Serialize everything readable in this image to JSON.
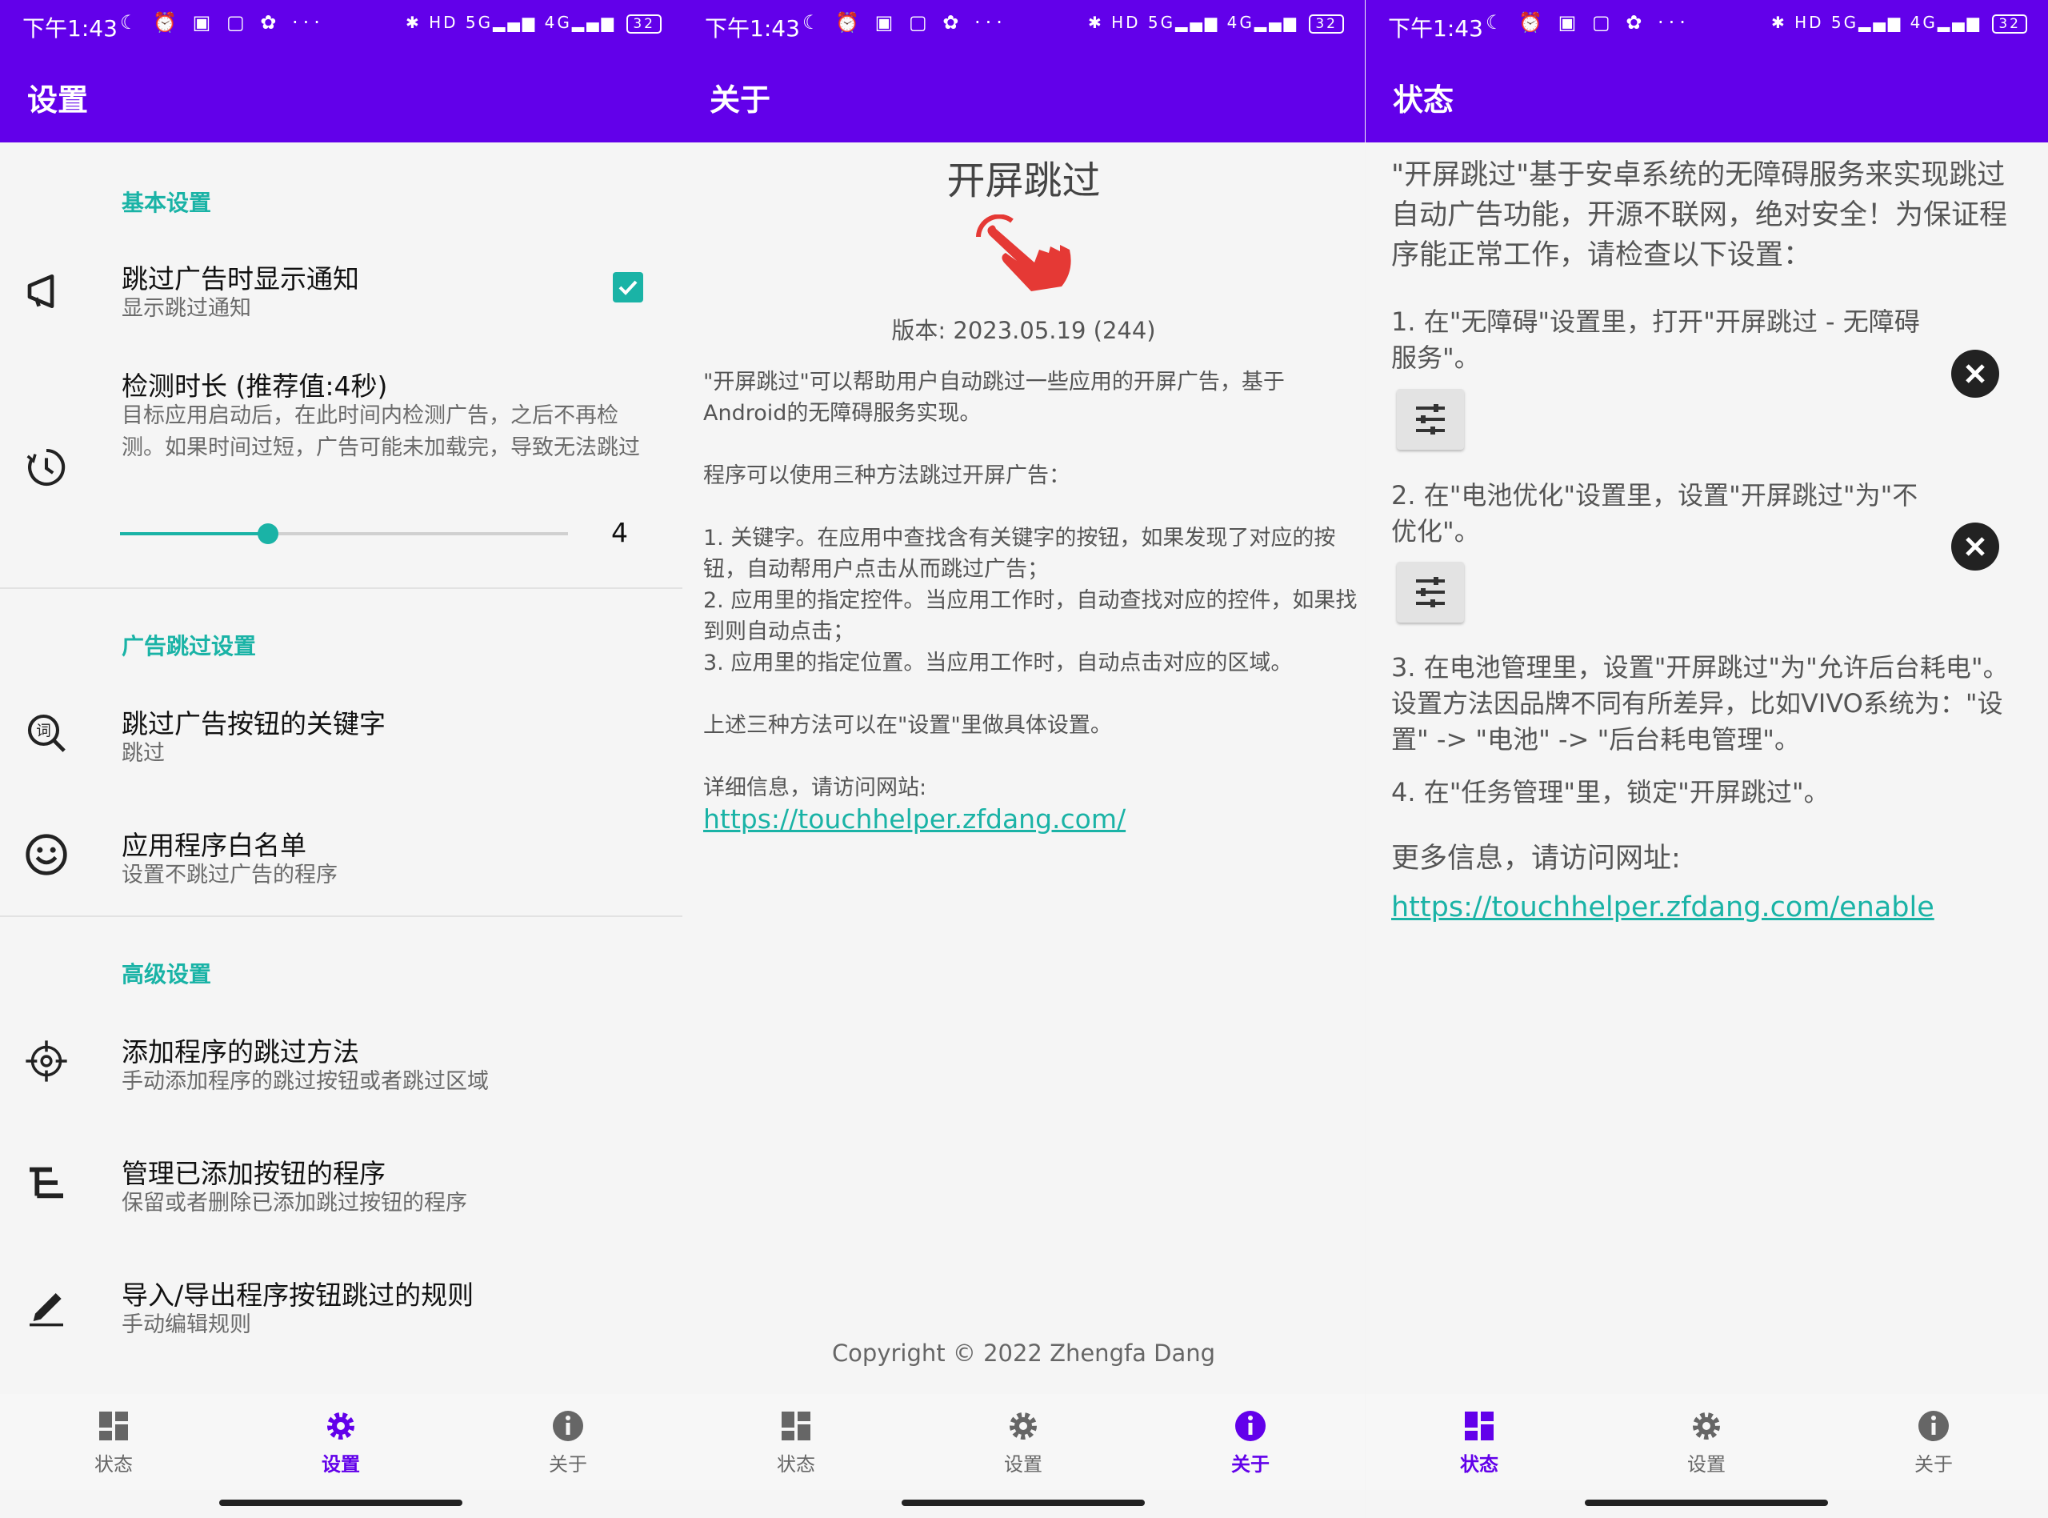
{
  "status_bar": {
    "time": "下午1:43",
    "left_icons": "☾ ⏰ ▣ ▢ ✿ ···",
    "right_icons": "✱ HD 5G▂▄▆ 4G▂▄▆",
    "battery": "32"
  },
  "colors": {
    "primary": "#6200ea",
    "accent": "#1ab3a6",
    "link": "#1ab3a6"
  },
  "settings_screen": {
    "title": "设置",
    "section_basic": "基本设置",
    "pref_notify": {
      "title": "跳过广告时显示通知",
      "subtitle": "显示跳过通知",
      "checked": true
    },
    "pref_duration": {
      "title": "检测时长 (推荐值:4秒)",
      "subtitle": "目标应用启动后，在此时间内检测广告，之后不再检测。如果时间过短，广告可能未加载完，导致无法跳过",
      "value": "4",
      "fraction": 0.33
    },
    "section_ad": "广告跳过设置",
    "pref_keywords": {
      "title": "跳过广告按钮的关键字",
      "subtitle": "跳过"
    },
    "pref_whitelist": {
      "title": "应用程序白名单",
      "subtitle": "设置不跳过广告的程序"
    },
    "section_advanced": "高级设置",
    "pref_add_method": {
      "title": "添加程序的跳过方法",
      "subtitle": "手动添加程序的跳过按钮或者跳过区域"
    },
    "pref_manage": {
      "title": "管理已添加按钮的程序",
      "subtitle": "保留或者删除已添加跳过按钮的程序"
    },
    "pref_import": {
      "title": "导入/导出程序按钮跳过的规则",
      "subtitle": "手动编辑规则"
    }
  },
  "about_screen": {
    "title": "关于",
    "app_name": "开屏跳过",
    "version": "版本: 2023.05.19 (244)",
    "para1": "\"开屏跳过\"可以帮助用户自动跳过一些应用的开屏广告，基于Android的无障碍服务实现。",
    "para2": "程序可以使用三种方法跳过开屏广告：",
    "method1": "1. 关键字。在应用中查找含有关键字的按钮，如果发现了对应的按钮，自动帮用户点击从而跳过广告；",
    "method2": "2. 应用里的指定控件。当应用工作时，自动查找对应的控件，如果找到则自动点击；",
    "method3": "3. 应用里的指定位置。当应用工作时，自动点击对应的区域。",
    "para3": "上述三种方法可以在\"设置\"里做具体设置。",
    "para4": "详细信息，请访问网站:",
    "link": "https://touchhelper.zfdang.com/",
    "copyright": "Copyright © 2022 Zhengfa Dang"
  },
  "status_screen": {
    "title": "状态",
    "intro": "\"开屏跳过\"基于安卓系统的无障碍服务来实现跳过自动广告功能，开源不联网，绝对安全！为保证程序能正常工作，请检查以下设置：",
    "step1": "1. 在\"无障碍\"设置里，打开\"开屏跳过 - 无障碍服务\"。",
    "step2": "2. 在\"电池优化\"设置里，设置\"开屏跳过\"为\"不优化\"。",
    "step3": "3. 在电池管理里，设置\"开屏跳过\"为\"允许后台耗电\"。设置方法因品牌不同有所差异，比如VIVO系统为：\"设置\" -> \"电池\" -> \"后台耗电管理\"。",
    "step4": "4. 在\"任务管理\"里，锁定\"开屏跳过\"。",
    "more_info": "更多信息，请访问网址:",
    "link": "https://touchhelper.zfdang.com/enable"
  },
  "nav": {
    "status": "状态",
    "settings": "设置",
    "about": "关于"
  }
}
